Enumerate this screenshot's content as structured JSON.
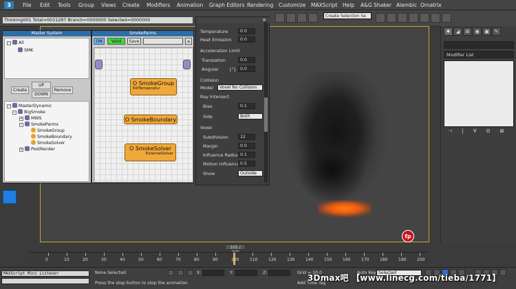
{
  "menubar": {
    "logo": "3",
    "items": [
      "File",
      "Edit",
      "Tools",
      "Group",
      "Views",
      "Create",
      "Modifiers",
      "Animation",
      "Graph Editors",
      "Rendering",
      "Customize",
      "MAXScript",
      "Help",
      "A&G Shaker",
      "Alembic",
      "Ornatrix"
    ]
  },
  "toolbar": {
    "selection_set": "Create Selection Se"
  },
  "info_bar": "Thinking001  Total=0031287  Branch=0000000  Selected=0000000",
  "master": {
    "title": "Master System",
    "top_tree": [
      {
        "label": "All"
      },
      {
        "label": "SMK"
      }
    ],
    "buttons": {
      "create": "Create",
      "up": "UP",
      "down": "DOWN",
      "remove": "Remove"
    },
    "tree": [
      {
        "label": "MasterDynamic"
      },
      {
        "label": "BigSmoke"
      },
      {
        "label": "MWS"
      },
      {
        "label": "SmokeParms"
      },
      {
        "label": "SmokeGroup"
      },
      {
        "label": "SmokeBoundary"
      },
      {
        "label": "SmokeSolver"
      },
      {
        "label": "PostRender"
      }
    ]
  },
  "smokeparms": {
    "title": "SmokeParms",
    "on": "ON",
    "valid": "Valid",
    "save": "Save",
    "nodes": {
      "group": {
        "title": "O SmokeGroup",
        "sub": "KillTemperatur"
      },
      "boundary": {
        "title": "O SmokeBoundary"
      },
      "solver": {
        "title": "O SmokeSolver",
        "sub": "ExternalSolver"
      }
    }
  },
  "props": {
    "close": "×",
    "temperature": {
      "label": "Temperature",
      "value": "0.0"
    },
    "heat_emission": {
      "label": "Heat Emission",
      "value": "0.0"
    },
    "accel_group": "Acceleration Limit",
    "translation": {
      "label": "Translation",
      "value": "0.0"
    },
    "angular": {
      "label": "Angular",
      "unit": "[°]",
      "value": "0.0"
    },
    "collision_group": "Collision",
    "model": {
      "label": "Model",
      "value": "Voxel No Collision"
    },
    "ray_group": "Ray Intersect",
    "bias": {
      "label": "Bias",
      "value": "0.1"
    },
    "side": {
      "label": "Side",
      "value": "Both"
    },
    "voxel_group": "Voxel",
    "subdivision": {
      "label": "Subdivision",
      "value": "12"
    },
    "margin": {
      "label": "Margin",
      "value": "0.0"
    },
    "influence_radius": {
      "label": "Influence Radius",
      "value": "0.1"
    },
    "motion_influence": {
      "label": "Motion Influence",
      "value": "0.5"
    },
    "show": {
      "label": "Show",
      "value": "Outside"
    }
  },
  "right_panel": {
    "modifier_list": "Modifier List",
    "stack_buttons": "⊣ | ∀ ʘ ⊠"
  },
  "viewport": {
    "logo": "fp"
  },
  "timeline": {
    "frame_indicator": "101 / 200",
    "ticks": [
      "0",
      "10",
      "20",
      "30",
      "40",
      "50",
      "60",
      "70",
      "80",
      "90",
      "100",
      "110",
      "120",
      "130",
      "140",
      "150",
      "160",
      "170",
      "180",
      "190",
      "200"
    ]
  },
  "statusbar": {
    "listener": "MAXScript Mini Listener",
    "none_selected": "None Selected",
    "hint": "Press the stop button to stop the animation",
    "x_label": "X:",
    "y_label": "Y:",
    "z_label": "Z:",
    "grid": "Grid = 10.0",
    "add_time_tag": "Add Time Tag",
    "auto_key": "Auto Key",
    "selected": "Selected",
    "watermark": "3Dmax吧 【www.linecg.com/tieba/1771】"
  }
}
